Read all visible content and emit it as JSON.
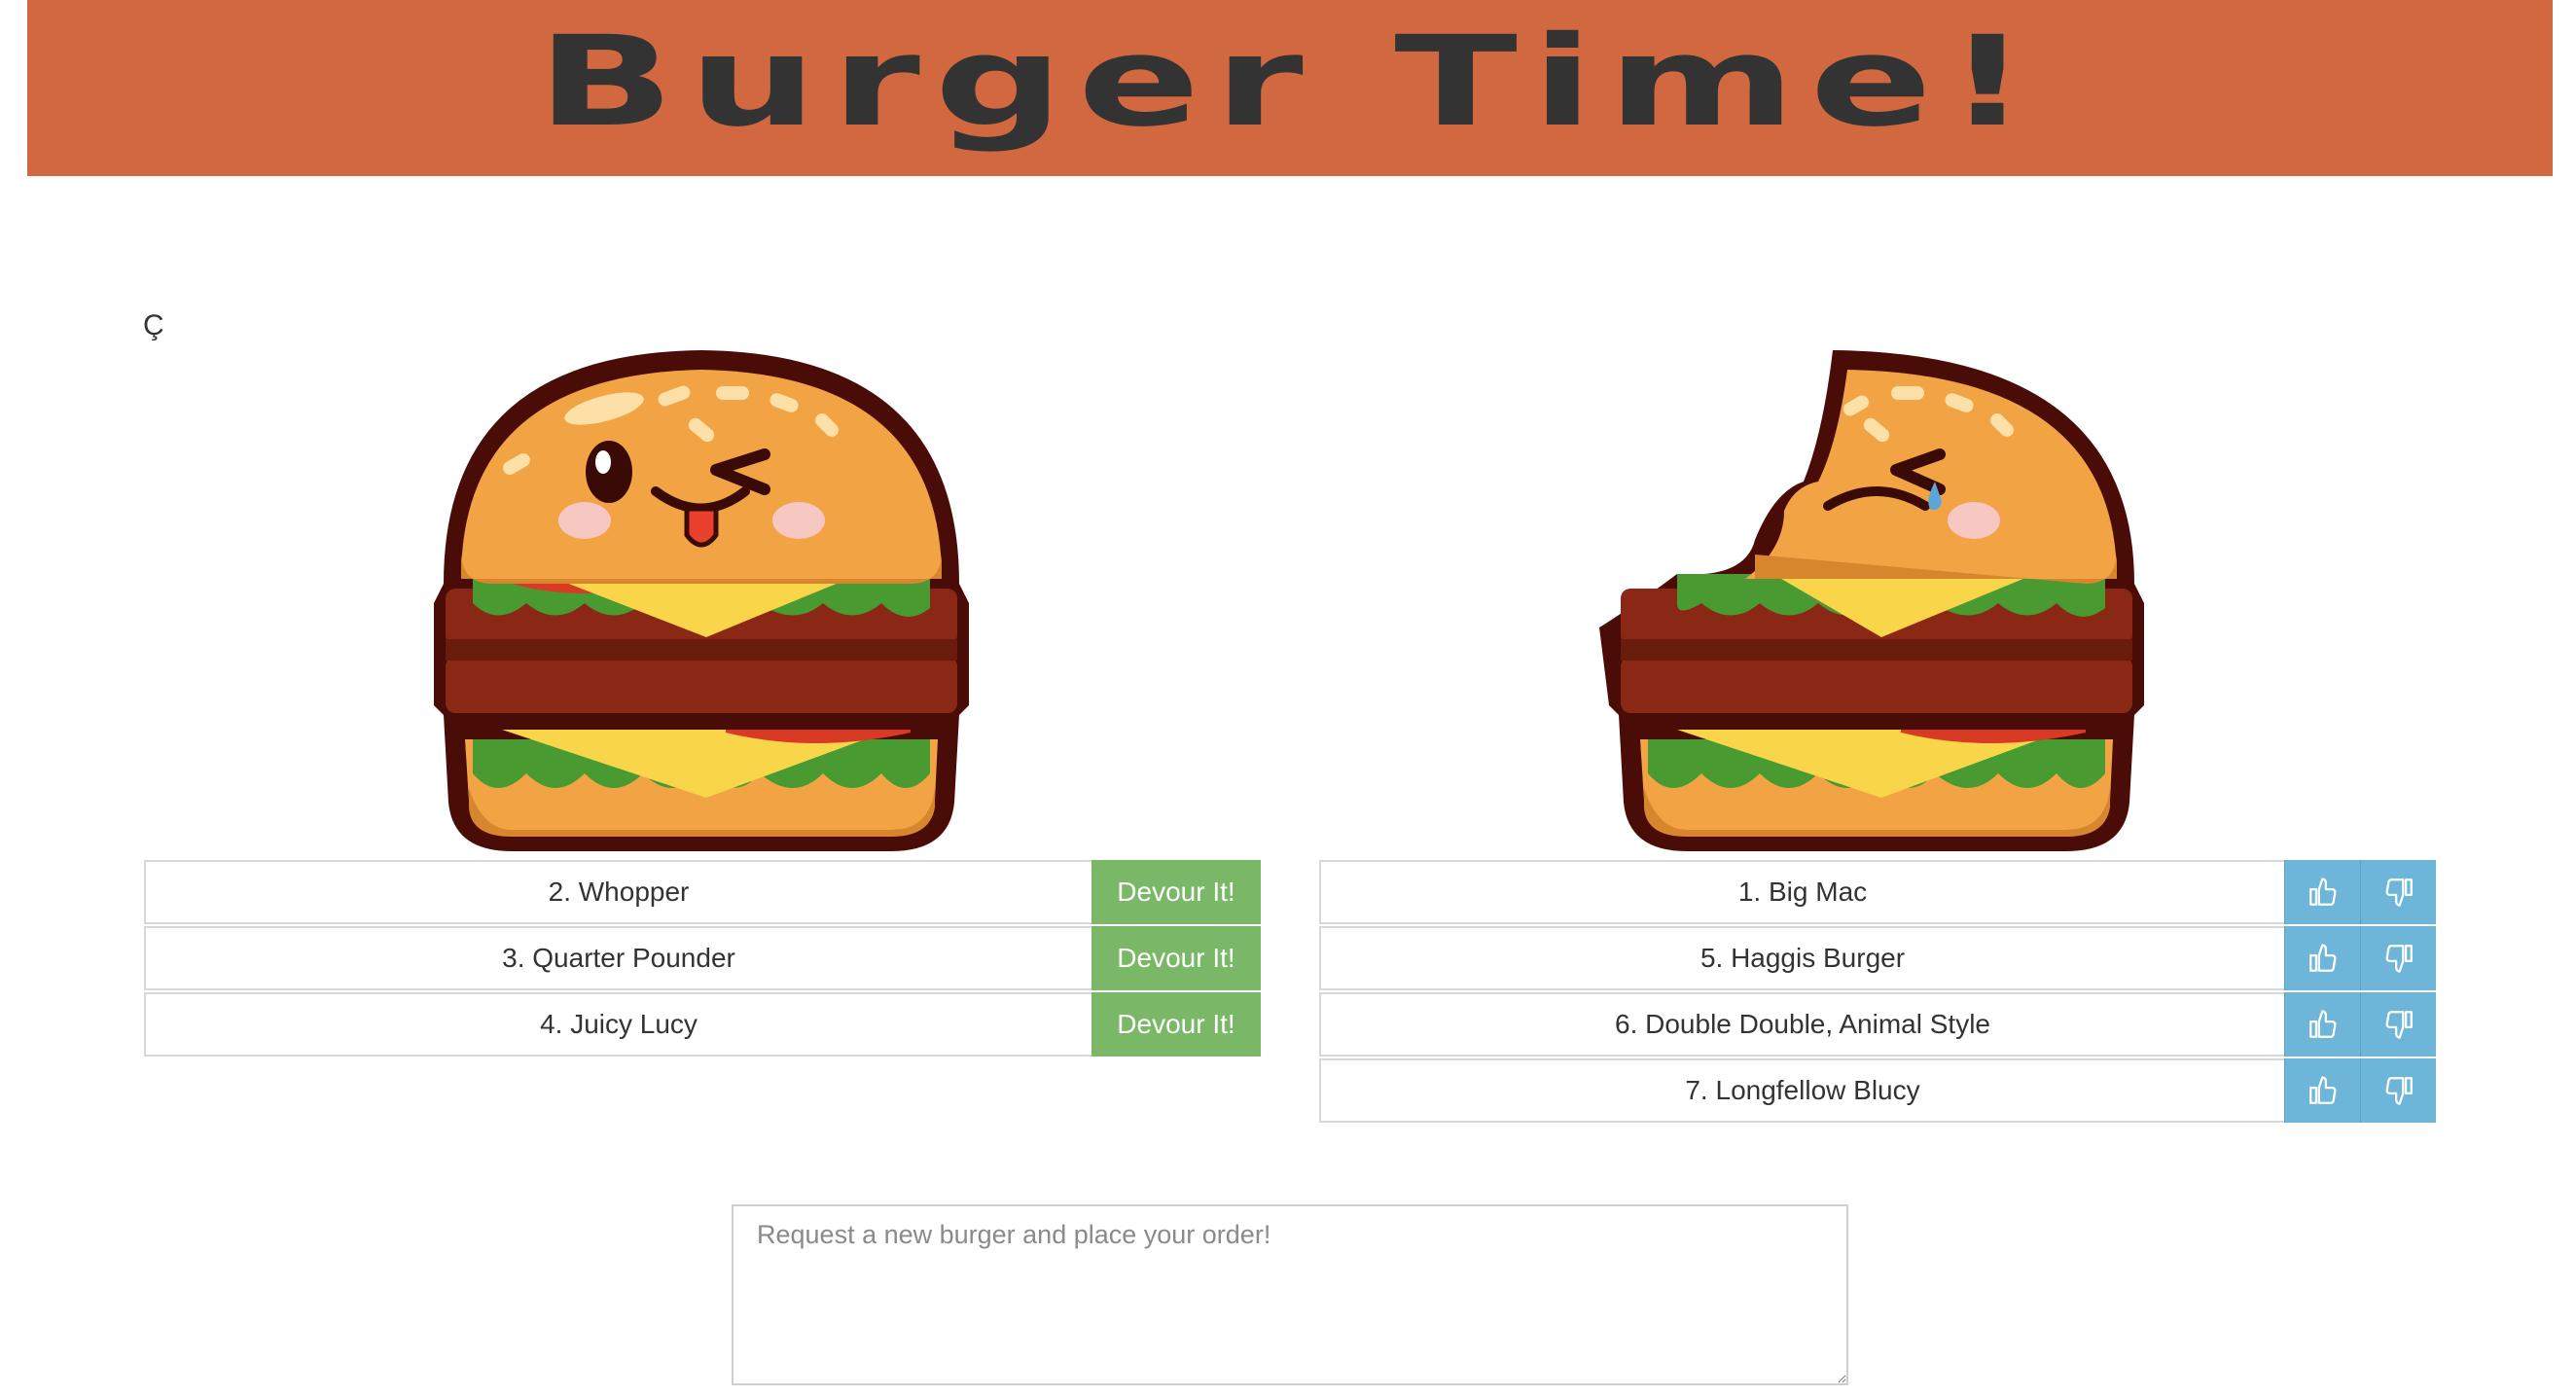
{
  "header": {
    "title": "Burger Time!"
  },
  "stray_char": "Ç",
  "colors": {
    "header_bg": "#d16840",
    "devour_button": "#7ab867",
    "vote_button": "#6db6d9"
  },
  "uneaten": {
    "image": "happy-burger-icon",
    "items": [
      {
        "label": "2. Whopper",
        "button": "Devour It!"
      },
      {
        "label": "3. Quarter Pounder",
        "button": "Devour It!"
      },
      {
        "label": "4. Juicy Lucy",
        "button": "Devour It!"
      }
    ]
  },
  "devoured": {
    "image": "bitten-burger-icon",
    "items": [
      {
        "label": "1. Big Mac"
      },
      {
        "label": "5. Haggis Burger"
      },
      {
        "label": "6. Double Double, Animal Style"
      },
      {
        "label": "7. Longfellow Blucy"
      }
    ]
  },
  "request": {
    "placeholder": "Request a new burger and place your order!"
  }
}
